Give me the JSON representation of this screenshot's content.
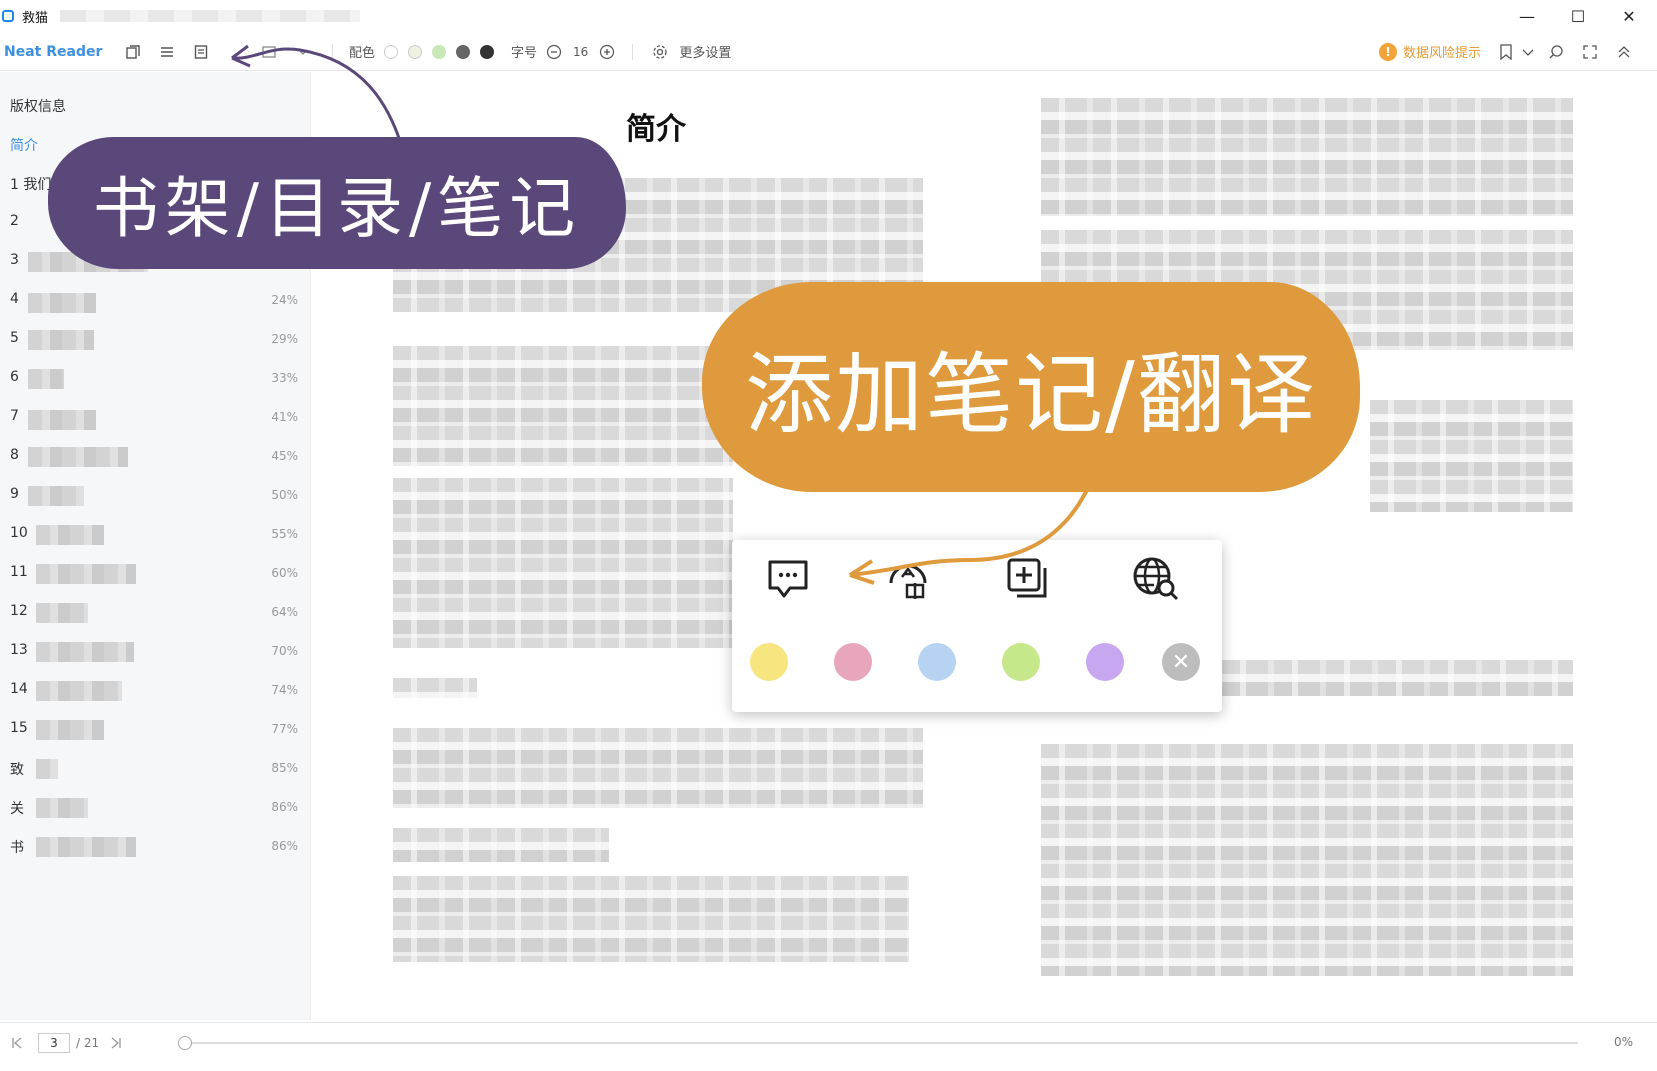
{
  "window": {
    "title": "救猫",
    "controls": [
      "—",
      "☐",
      "✕"
    ]
  },
  "toolbar": {
    "brand": "Neat Reader",
    "color_label": "配色",
    "font_size_label": "字号",
    "font_size_value": "16",
    "more_settings": "更多设置",
    "risk_notice": "数据风险提示",
    "swatch_colors": [
      "#ffffff",
      "#eef2e2",
      "#c8e8b8",
      "#666666",
      "#333333"
    ]
  },
  "sidebar": {
    "items": [
      {
        "label": "版权信息",
        "pct": ""
      },
      {
        "label": "简介",
        "pct": "",
        "active": true
      },
      {
        "label": "1 我们",
        "pct": ""
      },
      {
        "label": "2",
        "pct": ""
      },
      {
        "label": "3",
        "pct": ""
      },
      {
        "label": "4",
        "pct": "24%"
      },
      {
        "label": "5",
        "pct": "29%"
      },
      {
        "label": "6",
        "pct": "33%"
      },
      {
        "label": "7",
        "pct": "41%"
      },
      {
        "label": "8",
        "pct": "45%"
      },
      {
        "label": "9",
        "pct": "50%"
      },
      {
        "label": "10",
        "pct": "55%"
      },
      {
        "label": "11",
        "pct": "60%"
      },
      {
        "label": "12",
        "pct": "64%"
      },
      {
        "label": "13",
        "pct": "70%"
      },
      {
        "label": "14",
        "pct": "74%"
      },
      {
        "label": "15",
        "pct": "77%"
      },
      {
        "label": "致",
        "pct": "85%"
      },
      {
        "label": "关",
        "pct": "86%"
      },
      {
        "label": "书",
        "pct": "86%"
      }
    ]
  },
  "content": {
    "heading": "简介"
  },
  "popup": {
    "actions": [
      "comment-icon",
      "translate-icon",
      "add-note-icon",
      "web-search-icon"
    ],
    "highlight_colors": [
      "#f7e680",
      "#e8a6bd",
      "#b6d4f1",
      "#c7e88a",
      "#c7a7ef"
    ]
  },
  "annotations": {
    "sidebar_callout": "书架/目录/笔记",
    "popup_callout": "添加笔记/翻译"
  },
  "footer": {
    "page_current": "3",
    "page_total": "/ 21",
    "progress": "0%"
  }
}
